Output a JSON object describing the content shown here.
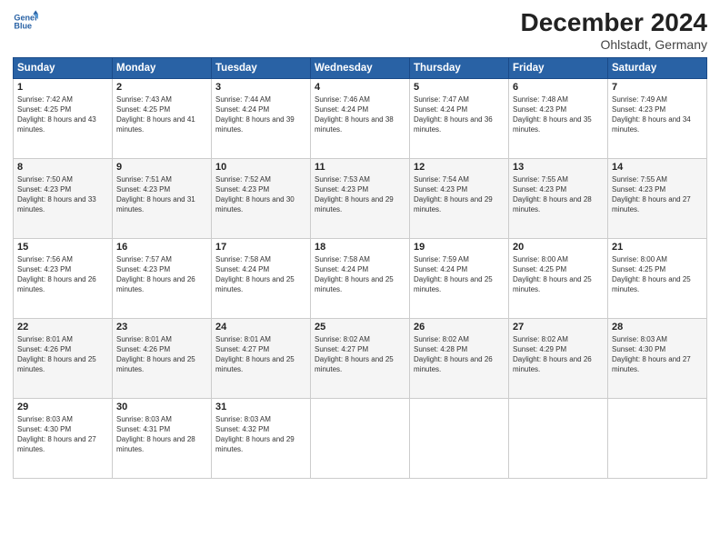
{
  "header": {
    "logo_line1": "General",
    "logo_line2": "Blue",
    "month": "December 2024",
    "location": "Ohlstadt, Germany"
  },
  "days_of_week": [
    "Sunday",
    "Monday",
    "Tuesday",
    "Wednesday",
    "Thursday",
    "Friday",
    "Saturday"
  ],
  "weeks": [
    [
      {
        "day": 1,
        "sunrise": "7:42 AM",
        "sunset": "4:25 PM",
        "daylight": "8 hours and 43 minutes."
      },
      {
        "day": 2,
        "sunrise": "7:43 AM",
        "sunset": "4:25 PM",
        "daylight": "8 hours and 41 minutes."
      },
      {
        "day": 3,
        "sunrise": "7:44 AM",
        "sunset": "4:24 PM",
        "daylight": "8 hours and 39 minutes."
      },
      {
        "day": 4,
        "sunrise": "7:46 AM",
        "sunset": "4:24 PM",
        "daylight": "8 hours and 38 minutes."
      },
      {
        "day": 5,
        "sunrise": "7:47 AM",
        "sunset": "4:24 PM",
        "daylight": "8 hours and 36 minutes."
      },
      {
        "day": 6,
        "sunrise": "7:48 AM",
        "sunset": "4:23 PM",
        "daylight": "8 hours and 35 minutes."
      },
      {
        "day": 7,
        "sunrise": "7:49 AM",
        "sunset": "4:23 PM",
        "daylight": "8 hours and 34 minutes."
      }
    ],
    [
      {
        "day": 8,
        "sunrise": "7:50 AM",
        "sunset": "4:23 PM",
        "daylight": "8 hours and 33 minutes."
      },
      {
        "day": 9,
        "sunrise": "7:51 AM",
        "sunset": "4:23 PM",
        "daylight": "8 hours and 31 minutes."
      },
      {
        "day": 10,
        "sunrise": "7:52 AM",
        "sunset": "4:23 PM",
        "daylight": "8 hours and 30 minutes."
      },
      {
        "day": 11,
        "sunrise": "7:53 AM",
        "sunset": "4:23 PM",
        "daylight": "8 hours and 29 minutes."
      },
      {
        "day": 12,
        "sunrise": "7:54 AM",
        "sunset": "4:23 PM",
        "daylight": "8 hours and 29 minutes."
      },
      {
        "day": 13,
        "sunrise": "7:55 AM",
        "sunset": "4:23 PM",
        "daylight": "8 hours and 28 minutes."
      },
      {
        "day": 14,
        "sunrise": "7:55 AM",
        "sunset": "4:23 PM",
        "daylight": "8 hours and 27 minutes."
      }
    ],
    [
      {
        "day": 15,
        "sunrise": "7:56 AM",
        "sunset": "4:23 PM",
        "daylight": "8 hours and 26 minutes."
      },
      {
        "day": 16,
        "sunrise": "7:57 AM",
        "sunset": "4:23 PM",
        "daylight": "8 hours and 26 minutes."
      },
      {
        "day": 17,
        "sunrise": "7:58 AM",
        "sunset": "4:24 PM",
        "daylight": "8 hours and 25 minutes."
      },
      {
        "day": 18,
        "sunrise": "7:58 AM",
        "sunset": "4:24 PM",
        "daylight": "8 hours and 25 minutes."
      },
      {
        "day": 19,
        "sunrise": "7:59 AM",
        "sunset": "4:24 PM",
        "daylight": "8 hours and 25 minutes."
      },
      {
        "day": 20,
        "sunrise": "8:00 AM",
        "sunset": "4:25 PM",
        "daylight": "8 hours and 25 minutes."
      },
      {
        "day": 21,
        "sunrise": "8:00 AM",
        "sunset": "4:25 PM",
        "daylight": "8 hours and 25 minutes."
      }
    ],
    [
      {
        "day": 22,
        "sunrise": "8:01 AM",
        "sunset": "4:26 PM",
        "daylight": "8 hours and 25 minutes."
      },
      {
        "day": 23,
        "sunrise": "8:01 AM",
        "sunset": "4:26 PM",
        "daylight": "8 hours and 25 minutes."
      },
      {
        "day": 24,
        "sunrise": "8:01 AM",
        "sunset": "4:27 PM",
        "daylight": "8 hours and 25 minutes."
      },
      {
        "day": 25,
        "sunrise": "8:02 AM",
        "sunset": "4:27 PM",
        "daylight": "8 hours and 25 minutes."
      },
      {
        "day": 26,
        "sunrise": "8:02 AM",
        "sunset": "4:28 PM",
        "daylight": "8 hours and 26 minutes."
      },
      {
        "day": 27,
        "sunrise": "8:02 AM",
        "sunset": "4:29 PM",
        "daylight": "8 hours and 26 minutes."
      },
      {
        "day": 28,
        "sunrise": "8:03 AM",
        "sunset": "4:30 PM",
        "daylight": "8 hours and 27 minutes."
      }
    ],
    [
      {
        "day": 29,
        "sunrise": "8:03 AM",
        "sunset": "4:30 PM",
        "daylight": "8 hours and 27 minutes."
      },
      {
        "day": 30,
        "sunrise": "8:03 AM",
        "sunset": "4:31 PM",
        "daylight": "8 hours and 28 minutes."
      },
      {
        "day": 31,
        "sunrise": "8:03 AM",
        "sunset": "4:32 PM",
        "daylight": "8 hours and 29 minutes."
      },
      null,
      null,
      null,
      null
    ]
  ]
}
